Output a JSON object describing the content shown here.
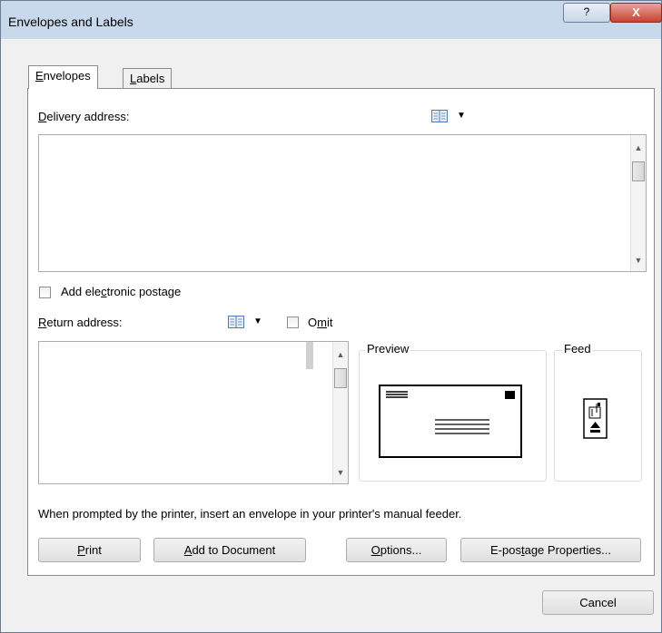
{
  "window": {
    "title": "Envelopes and Labels",
    "help_glyph": "?",
    "close_glyph": "X"
  },
  "tabs": [
    {
      "label_mnemonic": "E",
      "label_rest": "nvelopes"
    },
    {
      "label_mnemonic": "L",
      "label_rest": "abels"
    }
  ],
  "delivery": {
    "label_mnemonic": "D",
    "label_rest": "elivery address:",
    "value": ""
  },
  "epostage": {
    "label_pre": "Add ele",
    "label_mnemonic": "c",
    "label_post": "tronic postage",
    "checked": false
  },
  "return": {
    "label_mnemonic": "R",
    "label_rest": "eturn address:",
    "value": ""
  },
  "omit": {
    "label_pre": "O",
    "label_mnemonic": "m",
    "label_post": "it",
    "checked": false
  },
  "preview": {
    "label": "Preview"
  },
  "feed": {
    "label": "Feed"
  },
  "instruction": "When prompted by the printer, insert an envelope in your printer's manual feeder.",
  "buttons": {
    "print": {
      "mnemonic": "P",
      "rest": "rint"
    },
    "add_to_document": {
      "mnemonic": "A",
      "rest": "dd to Document"
    },
    "options": {
      "mnemonic": "O",
      "rest": "ptions..."
    },
    "epostage_properties": {
      "pre": "E-pos",
      "mnemonic": "t",
      "post": "age Properties..."
    },
    "cancel": "Cancel"
  }
}
